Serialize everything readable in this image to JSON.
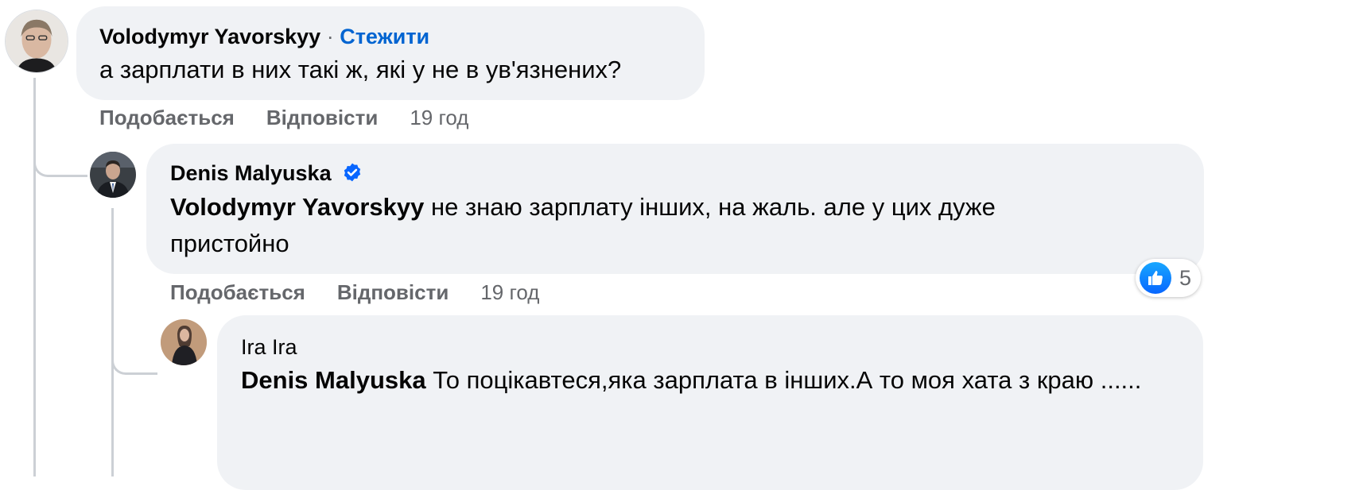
{
  "colors": {
    "bubble_bg": "#f0f2f5",
    "link_blue": "#0064d1",
    "meta_gray": "#65676b",
    "thread_line": "#ccd0d5",
    "like_blue": "#0866ff",
    "verified_blue": "#0866ff"
  },
  "comments": [
    {
      "author": "Volodymyr Yavorskyy",
      "follow_separator": "·",
      "follow_label": "Стежити",
      "text": "а зарплати в них такі ж, які у не в ув'язнених?",
      "like_label": "Подобається",
      "reply_label": "Відповісти",
      "time": "19 год",
      "avatar_icon": "user-avatar-photo"
    },
    {
      "author": "Denis Malyuska",
      "verified_icon": "verified-badge-icon",
      "mention": "Volodymyr Yavorskyy",
      "text": " не знаю зарплату інших, на жаль. але у цих дуже пристойно",
      "like_label": "Подобається",
      "reply_label": "Відповісти",
      "time": "19 год",
      "reaction_icon": "like-icon",
      "reaction_count": "5",
      "avatar_icon": "user-avatar-photo"
    },
    {
      "author": "Ira Ira",
      "mention": "Denis Malyuska",
      "text": " То поцікавтеся,яка зарплата в інших.А то моя хата з краю ......",
      "avatar_icon": "user-avatar-photo"
    }
  ]
}
